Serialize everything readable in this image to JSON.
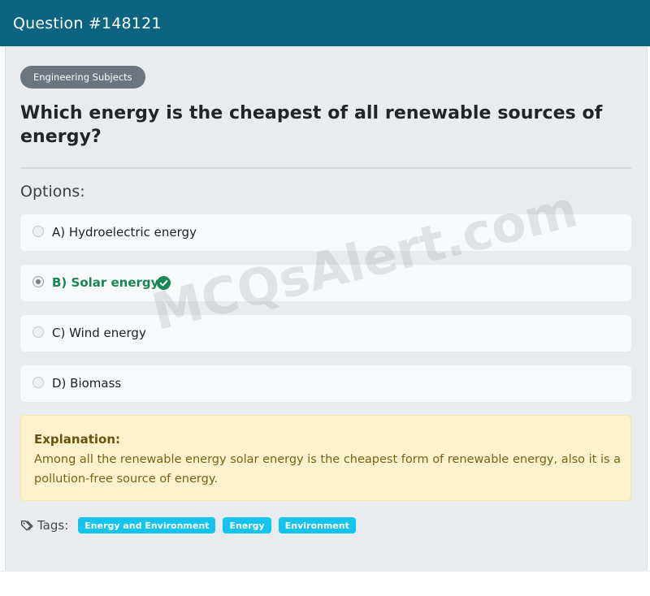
{
  "header": {
    "title": "Question #148121"
  },
  "category": "Engineering Subjects",
  "question": "Which energy is the cheapest of all renewable sources of energy?",
  "options_label": "Options:",
  "options": [
    {
      "label": "A) Hydroelectric energy",
      "selected": false,
      "correct": false
    },
    {
      "label": "B) Solar energy",
      "selected": true,
      "correct": true
    },
    {
      "label": "C) Wind energy",
      "selected": false,
      "correct": false
    },
    {
      "label": "D) Biomass",
      "selected": false,
      "correct": false
    }
  ],
  "explanation": {
    "title": "Explanation:",
    "text": "Among all the renewable energy solar energy is the cheapest form of renewable energy, also it is a pollution-free source of energy."
  },
  "tags": {
    "label": "Tags:",
    "items": [
      "Energy and Environment",
      "Energy",
      "Environment"
    ]
  },
  "watermark": "MCQsAlert.com",
  "colors": {
    "header": "#0c6480",
    "correct": "#198754",
    "tag": "#13c4ee",
    "explanation_bg": "#fdf2cc"
  },
  "icons": {
    "correct": "check-circle-icon",
    "tags": "tags-icon"
  }
}
